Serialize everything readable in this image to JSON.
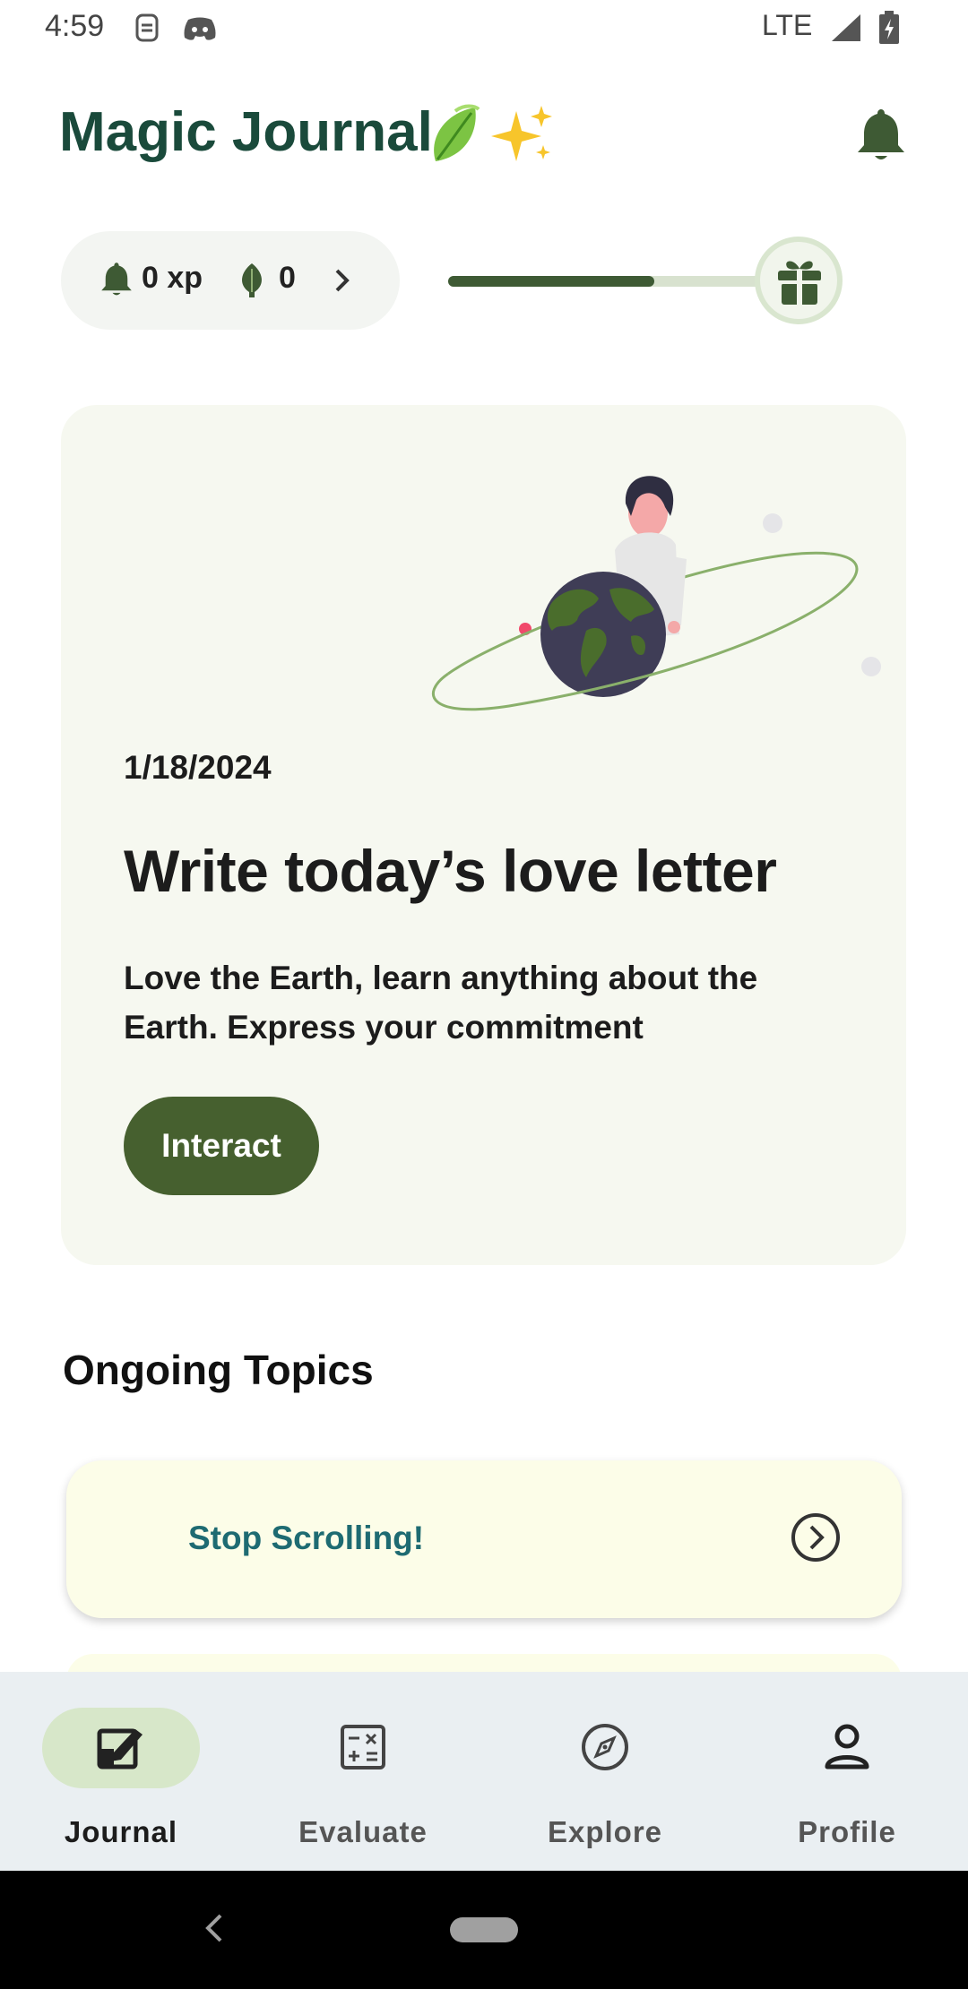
{
  "status_bar": {
    "time": "4:59",
    "network": "LTE",
    "icons": [
      "sim-icon",
      "discord-icon",
      "signal-icon",
      "battery-charging-icon"
    ]
  },
  "header": {
    "title": "Magic Journal",
    "emoji": [
      "leaf-emoji",
      "sparkles-emoji"
    ],
    "notification_icon": "bell-icon"
  },
  "stats": {
    "xp": "0 xp",
    "leaves": "0",
    "progress_fraction": 0.64,
    "reward_icon": "gift-icon"
  },
  "daily_card": {
    "date": "1/18/2024",
    "title": "Write today’s love letter",
    "description": "Love the Earth, learn anything about the Earth. Express your commitment",
    "button_label": "Interact",
    "illustration": "person-holding-earth-illustration"
  },
  "ongoing": {
    "section_title": "Ongoing Topics",
    "topics": [
      {
        "label": "Stop Scrolling!"
      }
    ]
  },
  "bottom_nav": {
    "items": [
      {
        "label": "Journal",
        "icon": "journal-icon",
        "active": true
      },
      {
        "label": "Evaluate",
        "icon": "calculator-icon",
        "active": false
      },
      {
        "label": "Explore",
        "icon": "compass-icon",
        "active": false
      },
      {
        "label": "Profile",
        "icon": "person-icon",
        "active": false
      }
    ]
  },
  "colors": {
    "brand_green": "#1a4a3b",
    "button_green": "#46602f",
    "card_background": "#f6f8f0",
    "topic_background": "#fcfde8",
    "nav_background": "#eaeff2"
  }
}
